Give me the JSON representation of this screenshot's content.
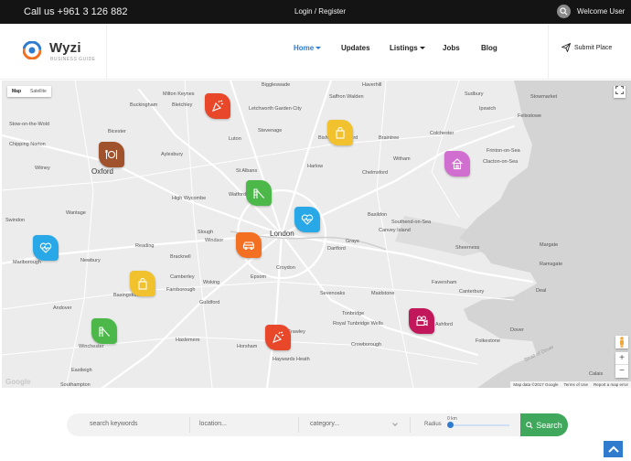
{
  "topbar": {
    "phone": "Call us +961 3 126 882",
    "login": "Login / Register",
    "welcome": "Welcome User"
  },
  "header": {
    "logo_title": "Wyzi",
    "logo_subtitle": "BUSINESS GUIDE",
    "nav": [
      {
        "label": "Home",
        "active": true,
        "dropdown": true
      },
      {
        "label": "Updates",
        "active": false,
        "dropdown": false
      },
      {
        "label": "Listings",
        "active": false,
        "dropdown": true
      },
      {
        "label": "Jobs",
        "active": false,
        "dropdown": false
      },
      {
        "label": "Blog",
        "active": false,
        "dropdown": false
      }
    ],
    "submit": "Submit Place",
    "accent": "#2f7ccf"
  },
  "map": {
    "type_options": [
      "Map",
      "Satellite"
    ],
    "selected_type": "Map",
    "attribution": [
      "Map data ©2017 Google",
      "Terms of Use",
      "Report a map error"
    ],
    "google_logo": "Google",
    "zoom_in": "+",
    "zoom_out": "−",
    "places": [
      "Biggleswade",
      "Haverhill",
      "Milton Keynes",
      "Saffron Walden",
      "Sudbury",
      "Buckingham",
      "Bletchley",
      "Letchworth Garden City",
      "Stowmarket",
      "Stow-on-the-Wold",
      "Ipswich",
      "Felixstowe",
      "Bicester",
      "Luton",
      "Stevenage",
      "Bishop's Stortford",
      "Braintree",
      "Colchester",
      "Chipping Norton",
      "Aylesbury",
      "Harlow",
      "Frinton-on-Sea",
      "Witney",
      "Oxford",
      "St Albans",
      "Witham",
      "Clacton-on-Sea",
      "Watford",
      "Chelmsford",
      "High Wycombe",
      "Wantage",
      "Basildon",
      "Swindon",
      "Slough",
      "Windsor",
      "London",
      "Southend-on-Sea",
      "Canvey Island",
      "Reading",
      "Bracknell",
      "Grays",
      "Dartford",
      "Marlborough",
      "Newbury",
      "Sheerness",
      "Margate",
      "Croydon",
      "Epsom",
      "Woking",
      "Camberley",
      "Farnborough",
      "Basingstoke",
      "Guildford",
      "Sevenoaks",
      "Faversham",
      "Canterbury",
      "Ramsgate",
      "Deal",
      "Andover",
      "Maidstone",
      "Tonbridge",
      "Royal Tunbridge Wells",
      "Ashford",
      "Winchester",
      "Crawley",
      "Haslemere",
      "Horsham",
      "Dover",
      "Folkestone",
      "Haywards Heath",
      "Crowborough",
      "Eastleigh",
      "Southampton",
      "Calais",
      "Strait of Dover"
    ],
    "markers": [
      {
        "icon": "party-popper-icon",
        "color": "#e8472a"
      },
      {
        "icon": "shopping-bag-icon",
        "color": "#f2c12e"
      },
      {
        "icon": "restaurant-icon",
        "color": "#a0522d"
      },
      {
        "icon": "house-icon",
        "color": "#d06fd0"
      },
      {
        "icon": "playground-icon",
        "color": "#4cb84a"
      },
      {
        "icon": "heart-icon",
        "color": "#29a8e8"
      },
      {
        "icon": "heart-icon",
        "color": "#29a8e8"
      },
      {
        "icon": "car-icon",
        "color": "#f36f21"
      },
      {
        "icon": "shopping-bag-icon",
        "color": "#f2c12e"
      },
      {
        "icon": "playground-icon",
        "color": "#4cb84a"
      },
      {
        "icon": "party-popper-icon",
        "color": "#e8472a"
      },
      {
        "icon": "camera-icon",
        "color": "#c2185b"
      }
    ]
  },
  "search": {
    "keywords_placeholder": "search keywords",
    "location_placeholder": "location...",
    "category_placeholder": "category...",
    "radius_label": "Radius",
    "radius_value": "0 km",
    "radius_fraction": 0,
    "button": "Search",
    "button_color": "#3fa85c"
  }
}
